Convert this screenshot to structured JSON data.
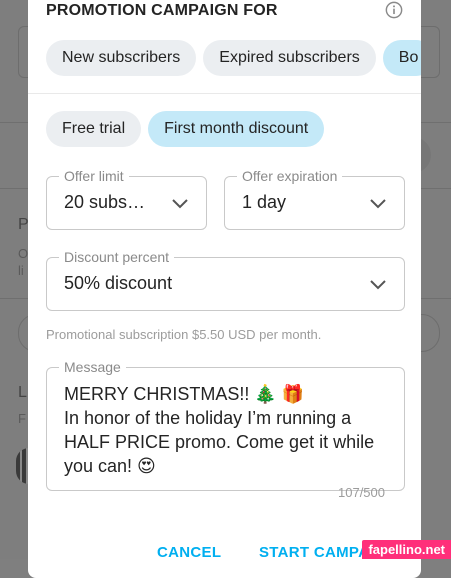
{
  "modal": {
    "title": "PROMOTION CAMPAIGN FOR",
    "audience_tabs": [
      {
        "label": "New subscribers",
        "active": false
      },
      {
        "label": "Expired subscribers",
        "active": false
      },
      {
        "label": "Bo",
        "active": true
      }
    ],
    "offer_types": [
      {
        "label": "Free trial",
        "active": false
      },
      {
        "label": "First month discount",
        "active": true
      }
    ],
    "offer_limit": {
      "label": "Offer limit",
      "value": "20 subs…"
    },
    "offer_expiration": {
      "label": "Offer expiration",
      "value": "1 day"
    },
    "discount": {
      "label": "Discount percent",
      "value": "50% discount"
    },
    "helper_text": "Promotional subscription $5.50 USD per month.",
    "message": {
      "label": "Message",
      "lines": [
        "MERRY CHRISTMAS!! 🎄 🎁",
        "In honor of the holiday I’m running a",
        "HALF PRICE promo. Come get it while",
        "you can! 😍"
      ],
      "counter": "107/500"
    },
    "actions": {
      "cancel": "CANCEL",
      "start": "START CAMPA"
    }
  },
  "watermark": "fapellino.net",
  "colors": {
    "accent": "#00aff0",
    "chip_active": "#c4e9f8",
    "chip": "#ebeef1"
  }
}
